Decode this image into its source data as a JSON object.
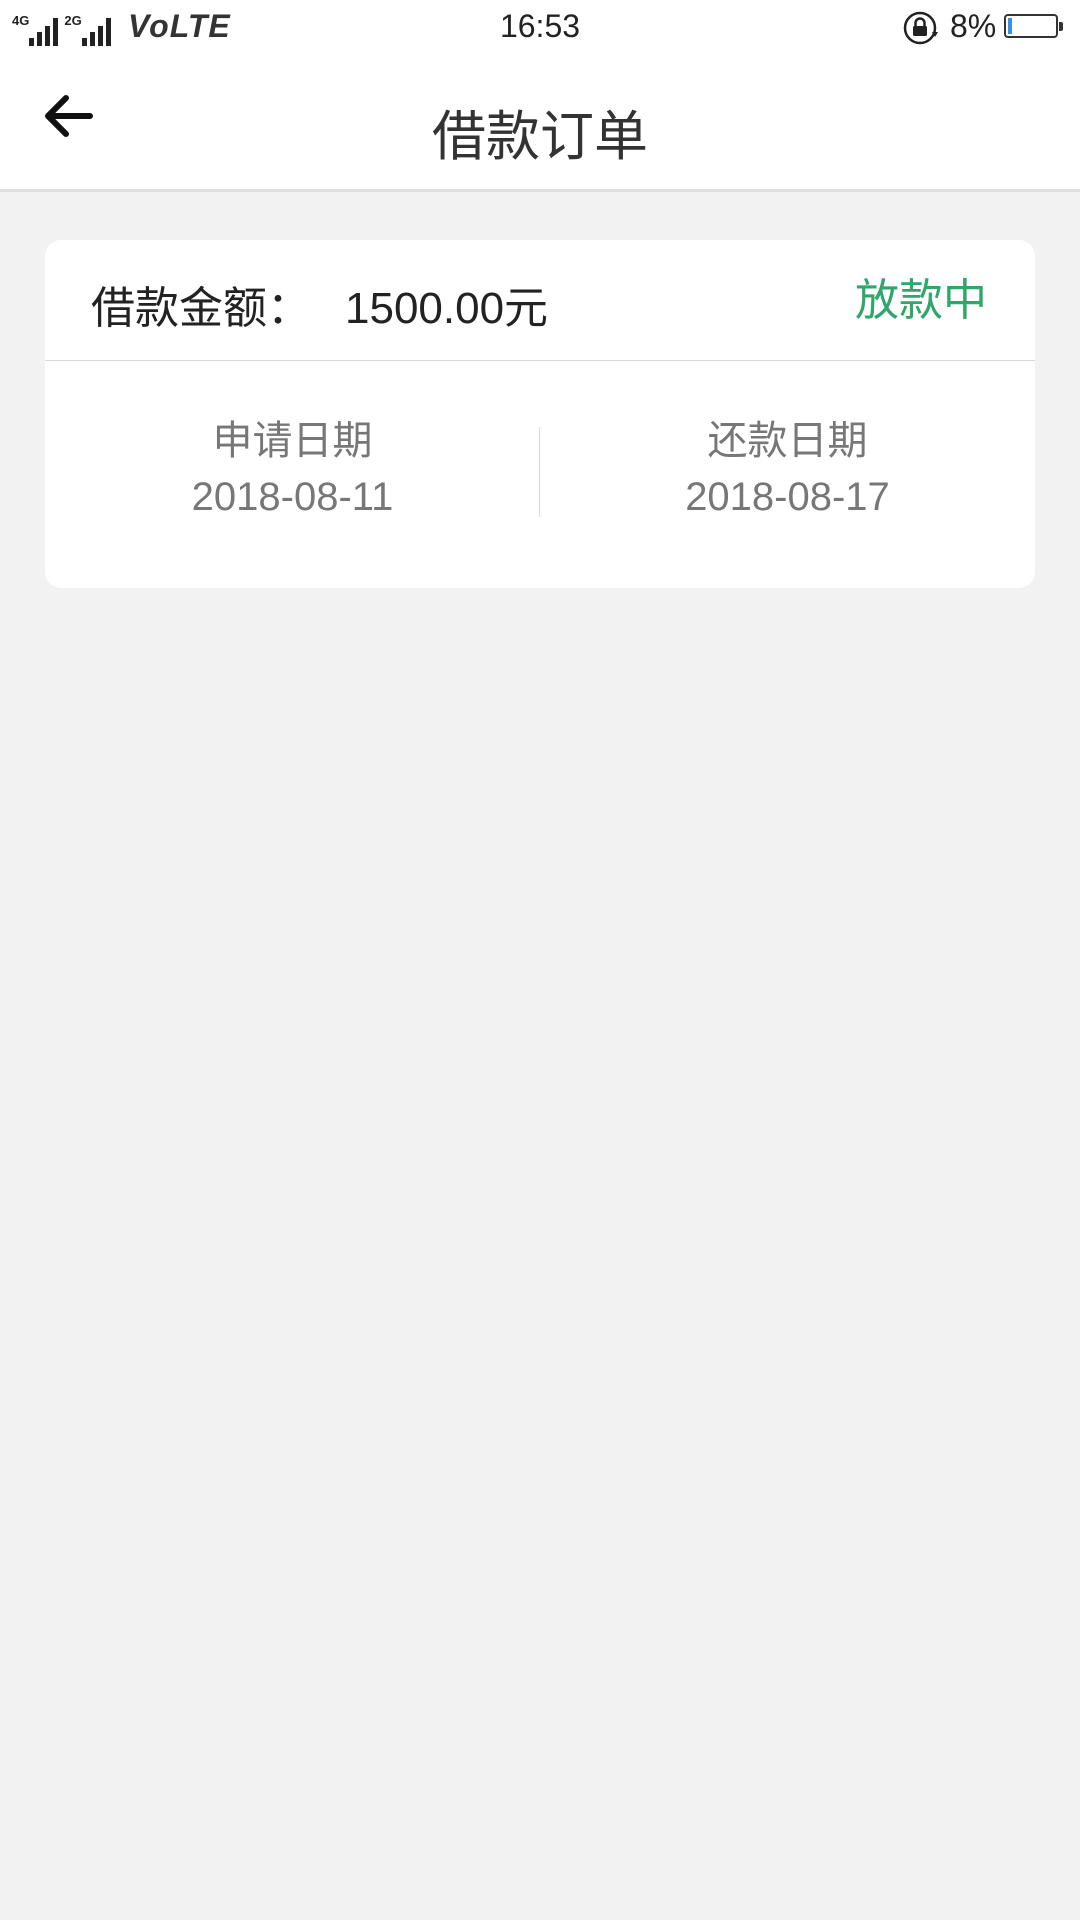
{
  "status_bar": {
    "sim1_tag": "4G",
    "sim2_tag": "2G",
    "volte": "VoLTE",
    "time": "16:53",
    "battery_percent": "8%",
    "battery_level": 0.08,
    "battery_color": "#3a8ee6"
  },
  "header": {
    "title": "借款订单",
    "back_icon": "arrow-left-icon"
  },
  "order": {
    "amount_label": "借款金额：",
    "amount_value": "1500.00元",
    "status": "放款中",
    "status_color": "#2fa66a",
    "apply_date_label": "申请日期",
    "apply_date": "2018-08-11",
    "repay_date_label": "还款日期",
    "repay_date": "2018-08-17"
  }
}
